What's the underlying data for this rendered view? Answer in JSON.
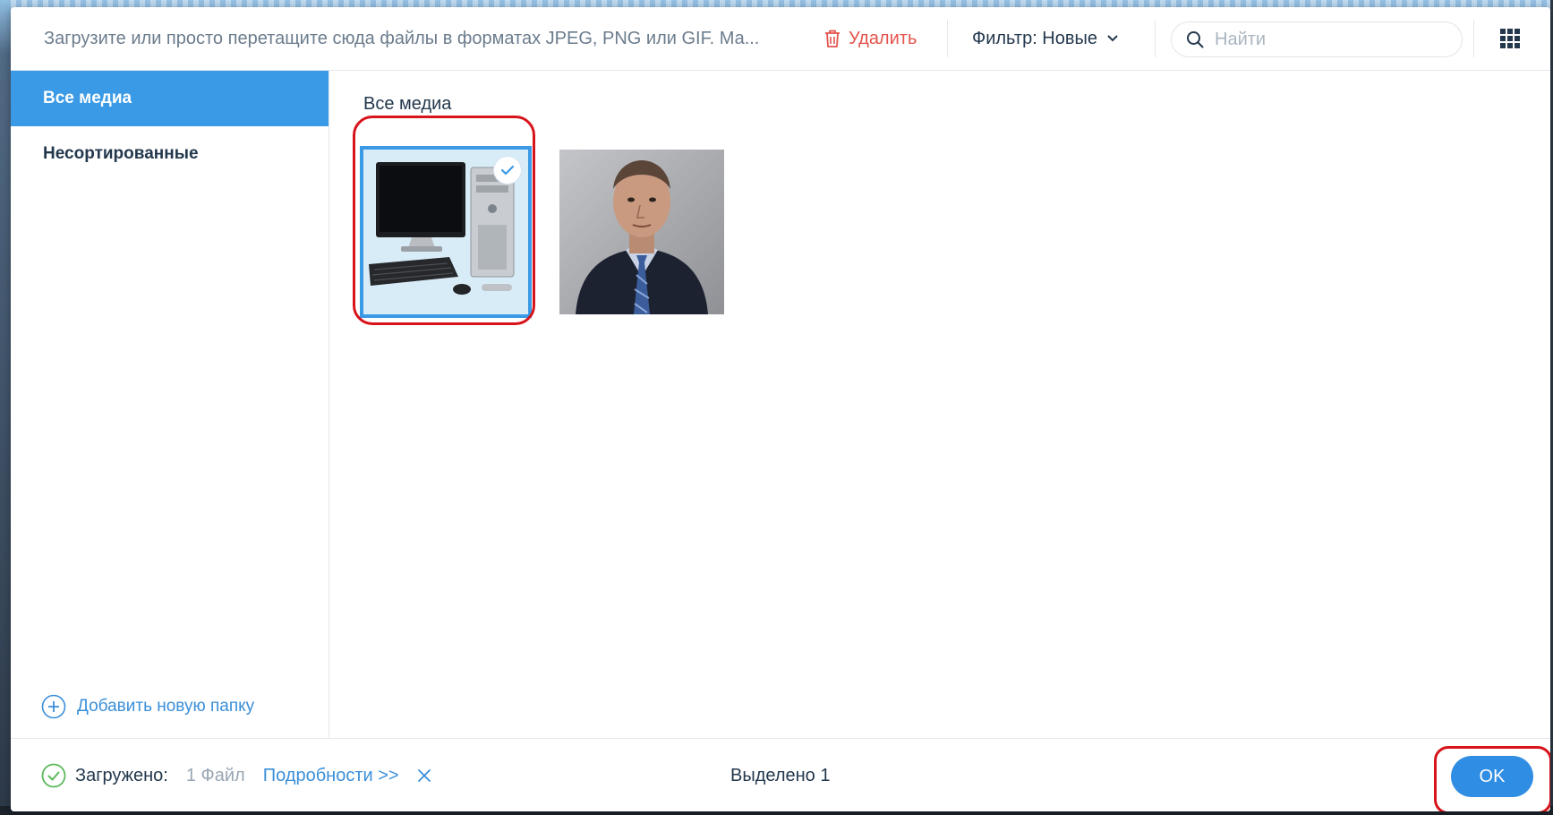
{
  "toolbar": {
    "upload_hint": "Загрузите или просто перетащите сюда файлы в форматах JPEG, PNG или GIF. Ма...",
    "delete_label": "Удалить",
    "filter_label": "Фильтр: Новые",
    "search_placeholder": "Найти",
    "icons": {
      "delete": "trash-icon",
      "filter": "chevron-down-icon",
      "search": "search-icon",
      "view": "grid-view-icon"
    }
  },
  "sidebar": {
    "items": [
      {
        "label": "Все медиа",
        "active": true
      },
      {
        "label": "Несортированные",
        "active": false
      }
    ],
    "add_folder_label": "Добавить новую папку",
    "add_folder_icon": "plus-circle-icon"
  },
  "main": {
    "section_title": "Все медиа",
    "media": [
      {
        "name": "computer-image",
        "selected": true,
        "selected_icon": "checkmark-icon"
      },
      {
        "name": "portrait-image",
        "selected": false
      }
    ]
  },
  "footer": {
    "status_label": "Загружено:",
    "status_count": "1 Файл",
    "details_link": "Подробности >>",
    "status_icon": "check-circle-icon",
    "close_icon": "close-icon",
    "selected_text": "Выделено 1",
    "ok_label": "OK"
  },
  "colors": {
    "accent": "#3a9ae6",
    "ok_button": "#2f8de4",
    "delete": "#e4534b",
    "highlight": "#d7141b",
    "success": "#5cb85c"
  }
}
